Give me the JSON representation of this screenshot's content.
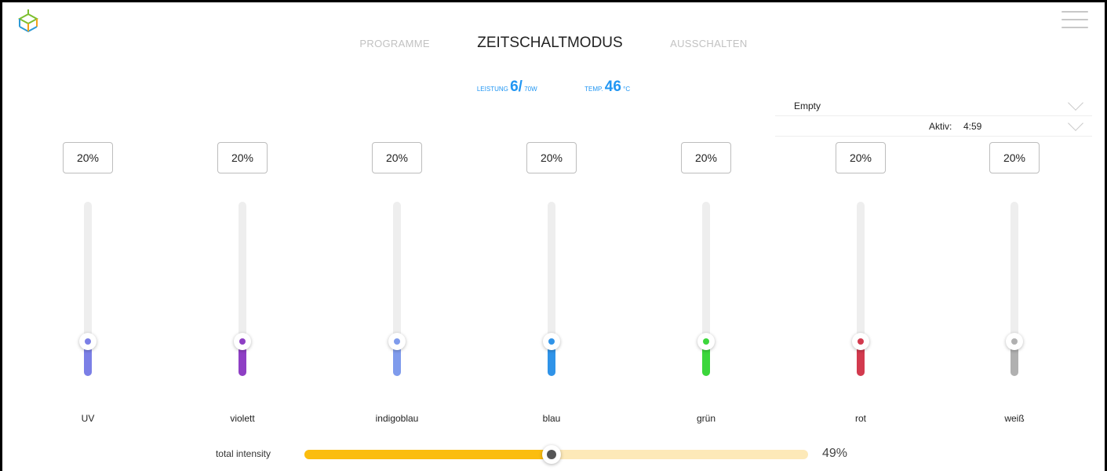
{
  "nav": {
    "tabs": [
      {
        "label": "PROGRAMME",
        "active": false
      },
      {
        "label": "ZEITSCHALTMODUS",
        "active": true
      },
      {
        "label": "AUSSCHALTEN",
        "active": false
      }
    ]
  },
  "stats": {
    "power_label": "LEISTUNG",
    "power_value": "6/",
    "power_unit": "70W",
    "temp_label": "TEMP.",
    "temp_value": "46",
    "temp_unit": "°C"
  },
  "program_select": {
    "value": "Empty"
  },
  "active_select": {
    "label": "Aktiv:",
    "value": "4:59"
  },
  "channels": [
    {
      "name": "UV",
      "percent": "20%",
      "level": 0.2,
      "color": "#7b7fe6"
    },
    {
      "name": "violett",
      "percent": "20%",
      "level": 0.2,
      "color": "#8e3fc4"
    },
    {
      "name": "indigoblau",
      "percent": "20%",
      "level": 0.2,
      "color": "#7f9bec"
    },
    {
      "name": "blau",
      "percent": "20%",
      "level": 0.2,
      "color": "#2f93e8"
    },
    {
      "name": "grün",
      "percent": "20%",
      "level": 0.2,
      "color": "#3bd63b"
    },
    {
      "name": "rot",
      "percent": "20%",
      "level": 0.2,
      "color": "#d23a4e"
    },
    {
      "name": "weiß",
      "percent": "20%",
      "level": 0.2,
      "color": "#b0b0b0"
    }
  ],
  "total": {
    "label": "total intensity",
    "percent": "49%",
    "level": 0.49
  },
  "icons": {
    "logo": "cube-logo-icon",
    "menu": "hamburger-menu-icon",
    "dropdown": "chevron-down-icon"
  }
}
